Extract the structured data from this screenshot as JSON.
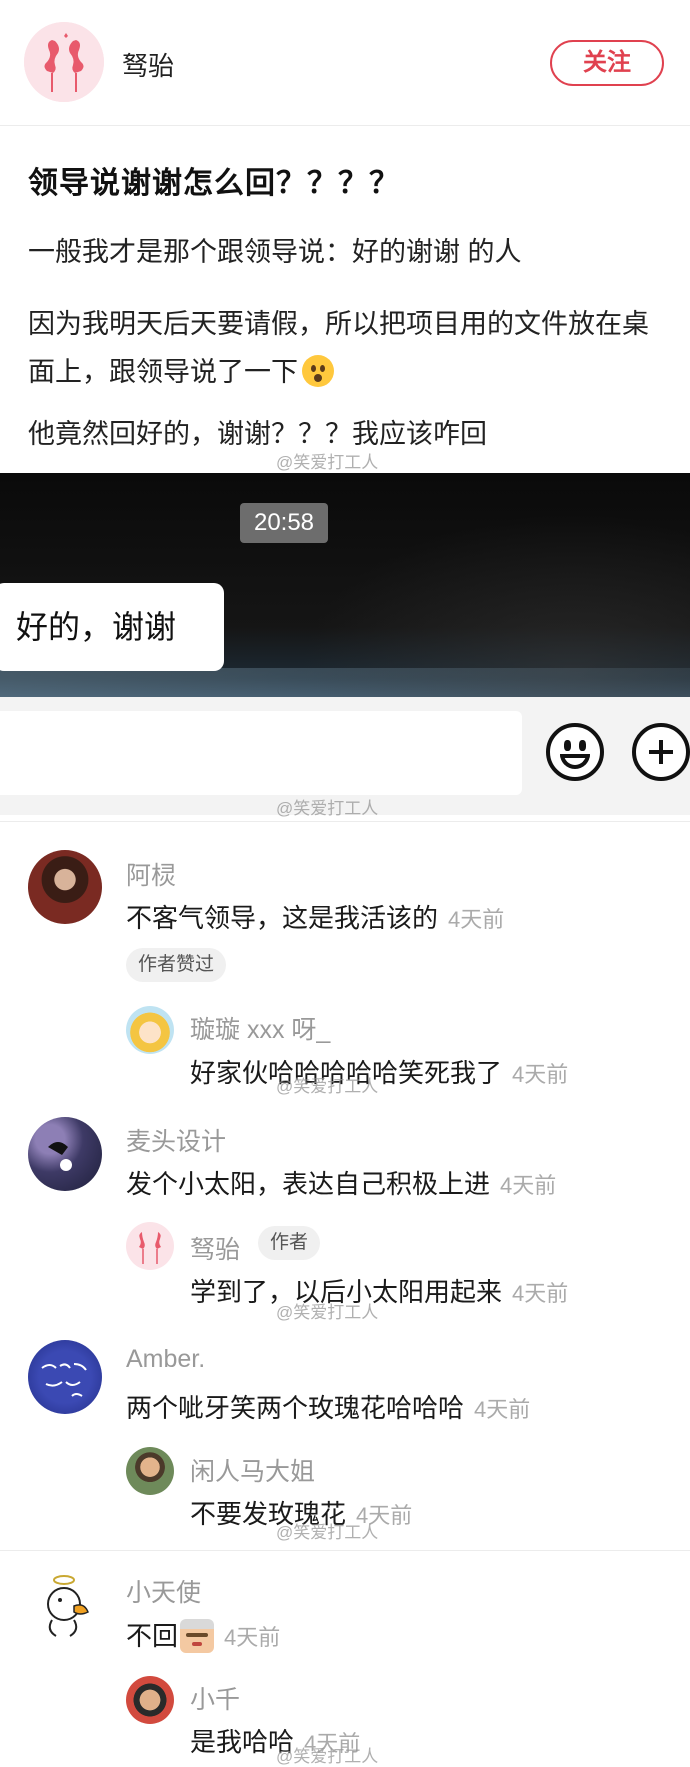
{
  "author": {
    "name": "驽骀",
    "follow_label": "关注"
  },
  "post": {
    "title": "领导说谢谢怎么回？？？？",
    "paragraphs": [
      "一般我才是那个跟领导说：好的谢谢 的人",
      "因为我明天后天要请假，所以把项目用的文件放在桌面上，跟领导说了一下",
      "他竟然回好的，谢谢？？？我应该咋回"
    ]
  },
  "watermark": "@笑爱打工人",
  "screenshot": {
    "timestamp": "20:58",
    "bubble_text": "好的，谢谢"
  },
  "comments": [
    {
      "name": "阿棂",
      "text": "不客气领导，这是我活该的",
      "time": "4天前",
      "tag": "作者赞过",
      "reply": {
        "name": "璇璇 xxx 呀_",
        "text": "好家伙哈哈哈哈哈笑死我了",
        "time": "4天前"
      }
    },
    {
      "name": "麦头设计",
      "text": "发个小太阳，表达自己积极上进",
      "time": "4天前",
      "reply": {
        "name": "驽骀",
        "badge": "作者",
        "text": "学到了，以后小太阳用起来",
        "time": "4天前"
      }
    },
    {
      "name": "Amber.",
      "text": "两个呲牙笑两个玫瑰花哈哈哈",
      "time": "4天前",
      "reply": {
        "name": "闲人马大姐",
        "text": "不要发玫瑰花",
        "time": "4天前"
      }
    },
    {
      "name": "小天使",
      "text": "不回",
      "time": "4天前",
      "reply": {
        "name": "小千",
        "text": "是我哈哈",
        "time": "4天前"
      }
    }
  ],
  "colors": {
    "accent": "#e0414f",
    "muted": "#999999",
    "time": "#aaaaaa"
  }
}
